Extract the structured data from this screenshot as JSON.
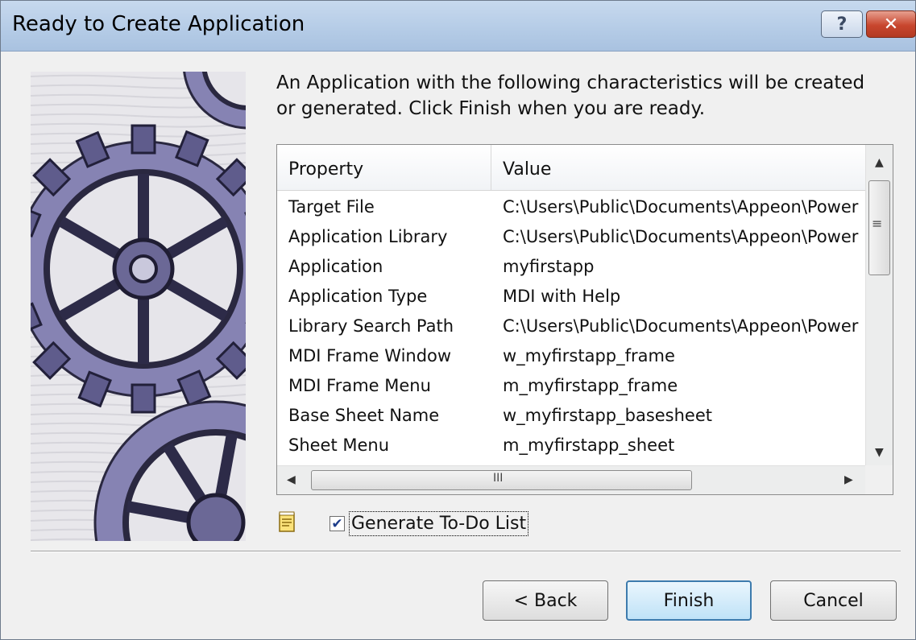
{
  "window": {
    "title": "Ready to Create Application",
    "help_label": "?",
    "close_label": "✕"
  },
  "description": "An Application with the following characteristics will be created or generated.  Click Finish when you are ready.",
  "table": {
    "columns": [
      "Property",
      "Value"
    ],
    "rows": [
      {
        "property": "Target File",
        "value": "C:\\Users\\Public\\Documents\\Appeon\\Power"
      },
      {
        "property": "Application Library",
        "value": "C:\\Users\\Public\\Documents\\Appeon\\Power"
      },
      {
        "property": "Application",
        "value": "myfirstapp"
      },
      {
        "property": "Application Type",
        "value": "MDI with Help"
      },
      {
        "property": "Library Search Path",
        "value": "C:\\Users\\Public\\Documents\\Appeon\\Power"
      },
      {
        "property": "MDI Frame Window",
        "value": "w_myfirstapp_frame"
      },
      {
        "property": "MDI Frame Menu",
        "value": "m_myfirstapp_frame"
      },
      {
        "property": "Base Sheet Name",
        "value": "w_myfirstapp_basesheet"
      },
      {
        "property": "Sheet Menu",
        "value": "m_myfirstapp_sheet"
      }
    ],
    "hscroll_grip": "III"
  },
  "todo": {
    "label": "Generate To-Do List",
    "checked": true,
    "check_glyph": "✔"
  },
  "buttons": {
    "back": "< Back",
    "finish": "Finish",
    "cancel": "Cancel"
  },
  "icons": [
    "gear-artwork",
    "help-icon",
    "close-icon",
    "todo-notepad-icon",
    "scroll-up-icon",
    "scroll-down-icon",
    "scroll-left-icon",
    "scroll-right-icon"
  ]
}
